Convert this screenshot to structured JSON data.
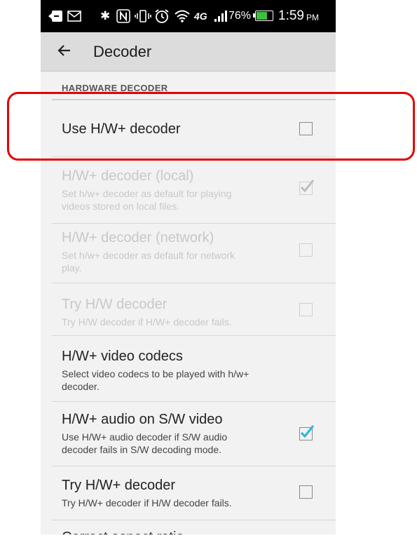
{
  "status_bar": {
    "battery_percent": "76%",
    "battery_level": 0.76,
    "time": "1:59",
    "ampm": "PM",
    "network": "4G",
    "icons": [
      "back-notification-icon",
      "mail-icon",
      "bluetooth-icon",
      "nfc-icon",
      "vibrate-icon",
      "alarm-icon",
      "wifi-icon",
      "lte-icon",
      "signal-icon",
      "battery-icon"
    ]
  },
  "action_bar": {
    "title": "Decoder",
    "back_icon": "arrow-left-icon"
  },
  "section": {
    "header": "HARDWARE DECODER"
  },
  "prefs": [
    {
      "title": "Use H/W+ decoder",
      "summary": "",
      "checked": false,
      "enabled": true
    },
    {
      "title": "H/W+ decoder (local)",
      "summary": "Set h/w+ decoder as default for playing videos stored on local files.",
      "summary_lines": [
        "Set h/w+ decoder as default for playing",
        "videos stored on local files."
      ],
      "checked": true,
      "enabled": false
    },
    {
      "title": "H/W+ decoder (network)",
      "summary": "Set h/w+ decoder as default for network play.",
      "summary_lines": [
        "Set h/w+ decoder as default for network",
        "play."
      ],
      "checked": false,
      "enabled": false
    },
    {
      "title": "Try H/W decoder",
      "summary": "Try H/W decoder if H/W+ decoder fails.",
      "summary_lines": [
        "Try H/W decoder if H/W+ decoder fails."
      ],
      "checked": false,
      "enabled": false
    },
    {
      "title": "H/W+ video codecs",
      "summary": "Select video codecs to be played with h/w+ decoder.",
      "summary_lines": [
        "Select video codecs to be played with h/w+",
        "decoder."
      ],
      "checked": null,
      "enabled": true
    },
    {
      "title": "H/W+ audio on S/W video",
      "summary": "Use H/W+ audio decoder if S/W audio decoder fails in S/W decoding mode.",
      "summary_lines": [
        "Use H/W+ audio decoder if S/W audio",
        "decoder fails in S/W decoding mode."
      ],
      "checked": true,
      "enabled": true
    },
    {
      "title": "Try H/W+ decoder",
      "summary": "Try H/W+ decoder if H/W decoder fails.",
      "summary_lines": [
        "Try H/W+ decoder if H/W decoder fails."
      ],
      "checked": false,
      "enabled": true
    },
    {
      "title": "Correct aspect ratio",
      "summary": "",
      "checked": true,
      "enabled": true
    }
  ],
  "colors": {
    "highlight": "#e60000",
    "check_accent": "#33b5e5",
    "check_disabled": "#bdbdbd"
  }
}
